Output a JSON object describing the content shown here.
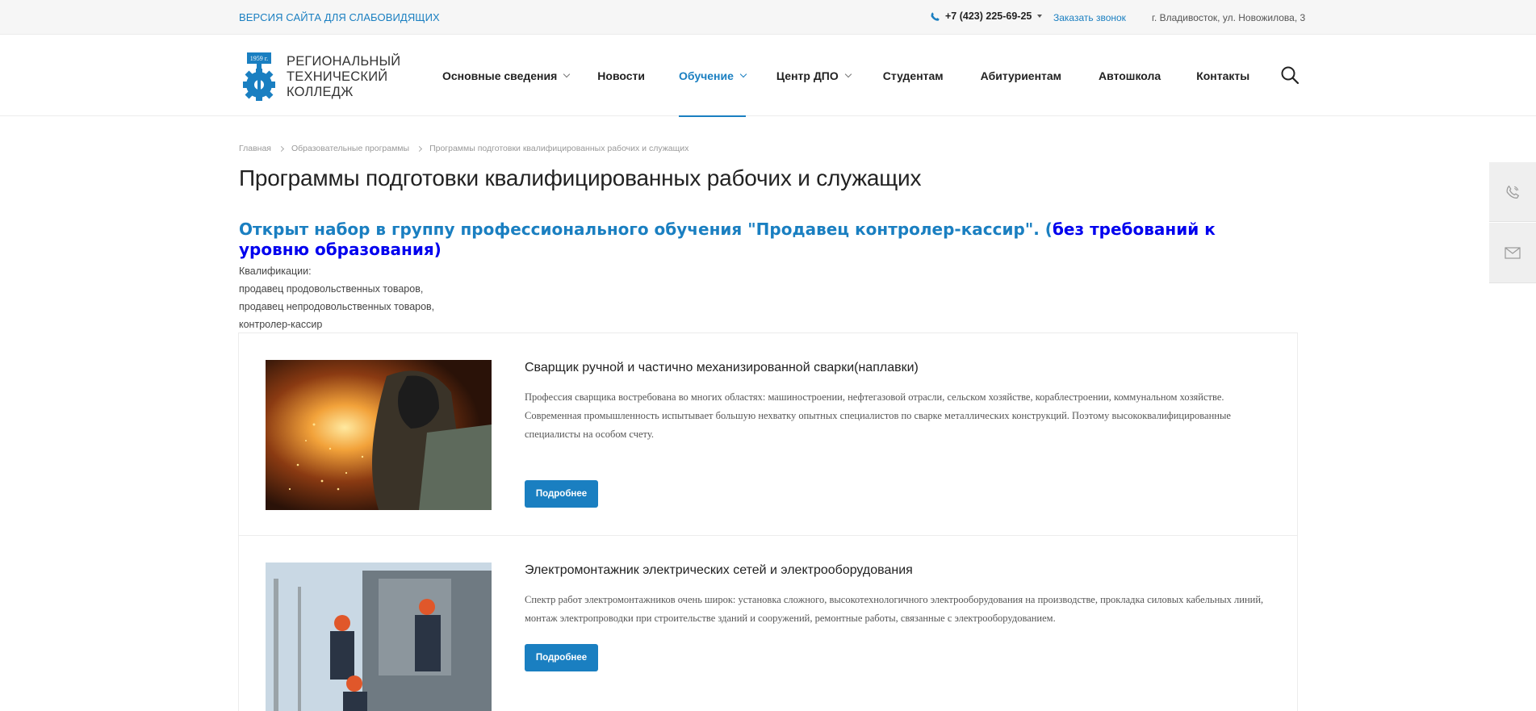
{
  "topbar": {
    "blind_version": "ВЕРСИЯ САЙТА ДЛЯ СЛАБОВИДЯЩИХ",
    "phone": "+7 (423) 225-69-25",
    "callback": "Заказать звонок",
    "address": "г. Владивосток, ул. Новожилова, 3"
  },
  "logo": {
    "year": "1959 г.",
    "line1": "Региональный",
    "line2": "технический",
    "line3": "колледж"
  },
  "nav": {
    "items": [
      {
        "label": "Основные сведения",
        "has_dropdown": true,
        "active": false
      },
      {
        "label": "Новости",
        "has_dropdown": false,
        "active": false
      },
      {
        "label": "Обучение",
        "has_dropdown": true,
        "active": true
      },
      {
        "label": "Центр ДПО",
        "has_dropdown": true,
        "active": false
      },
      {
        "label": "Студентам",
        "has_dropdown": false,
        "active": false
      },
      {
        "label": "Абитуриентам",
        "has_dropdown": false,
        "active": false
      },
      {
        "label": "Автошкола",
        "has_dropdown": false,
        "active": false
      },
      {
        "label": "Контакты",
        "has_dropdown": false,
        "active": false
      }
    ],
    "search_icon": "search-icon"
  },
  "breadcrumbs": [
    "Главная",
    "Образовательные программы",
    "Программы подготовки квалифицированных рабочих и служащих"
  ],
  "page": {
    "title": "Программы подготовки квалифицированных рабочих и служащих",
    "announce_part1": "Открыт набор в группу профессионального обучения \"Продавец контролер-кассир\". (",
    "announce_part2": "без требований к уровню образования)",
    "qualifications": [
      "Квалификации:",
      "продавец продовольственных товаров,",
      "продавец непродовольственных товаров,",
      "контролер-кассир"
    ]
  },
  "programs": [
    {
      "title": "Сварщик ручной и частично механизированной сварки(наплавки)",
      "text": "Профессия сварщика востребована во многих областях: машиностроении, нефтегазовой отрасли, сельском хозяйстве, кораблестроении, коммунальном хозяйстве. Современная промышленность испытывает большую нехватку опытных специалистов по сварке металлических конструкций. Поэтому высококвалифицированные специалисты на особом счету.",
      "button": "Подробнее"
    },
    {
      "title": "Электромонтажник электрических сетей и электрооборудования",
      "text": "Спектр работ электромонтажников очень широк: установка сложного, высокотехнологичного электрооборудования на производстве, прокладка силовых кабельных линий, монтаж электропроводки при строительстве зданий и сооружений, ремонтные работы, связанные с электрооборудованием.",
      "button": "Подробнее"
    }
  ],
  "side_widgets": [
    "phone-icon",
    "mail-icon"
  ],
  "colors": {
    "accent": "#1a7fc1",
    "announce_dark": "#0000ee"
  }
}
